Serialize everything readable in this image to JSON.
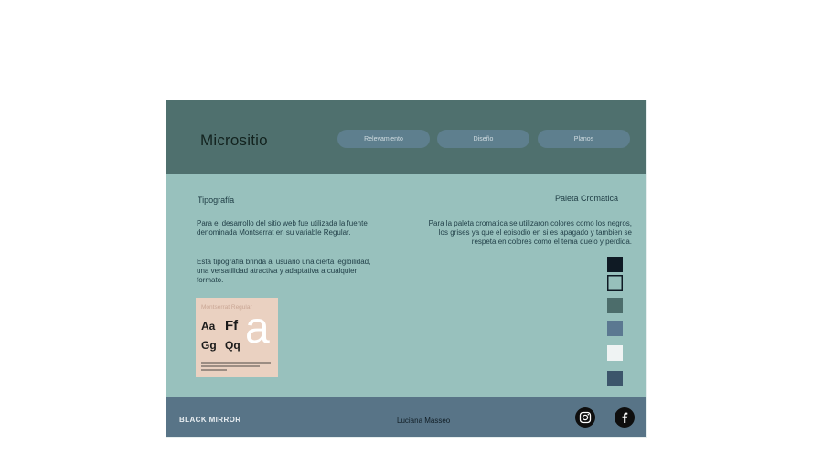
{
  "header": {
    "site_title": "Micrositio",
    "nav": [
      "Relevamiento",
      "Diseño",
      "Planos"
    ]
  },
  "typography": {
    "title": "Tipografía",
    "paragraph1": "Para el desarrollo del sitio web fue utilizada la fuente denominada Montserrat en su variable Regular.",
    "paragraph2": "Esta tipografía brinda al usuario una cierta legibilidad, una versatilidad atractiva y adaptativa a cualquier formato.",
    "specimen": {
      "title": "Montserrat Regular",
      "glyph1": "Aa",
      "glyph2": "Ff",
      "glyph3": "Gg",
      "glyph4": "Qq",
      "big_glyph": "a"
    }
  },
  "palette": {
    "title": "Paleta Cromatica",
    "paragraph": "Para la paleta cromatica se utilizaron colores como los negros, los grises ya que el episodio en si es apagado y tambien se respeta en colores como el tema duelo y perdida.",
    "swatches": [
      "#0f1a24",
      "#97c0bb",
      "#4c6d6b",
      "#5b7891",
      "#eff3f3",
      "#3c556b"
    ]
  },
  "footer": {
    "brand": "BLACK MIRROR",
    "author": "Luciana Masseo",
    "icons": [
      "instagram-icon",
      "facebook-icon"
    ]
  }
}
